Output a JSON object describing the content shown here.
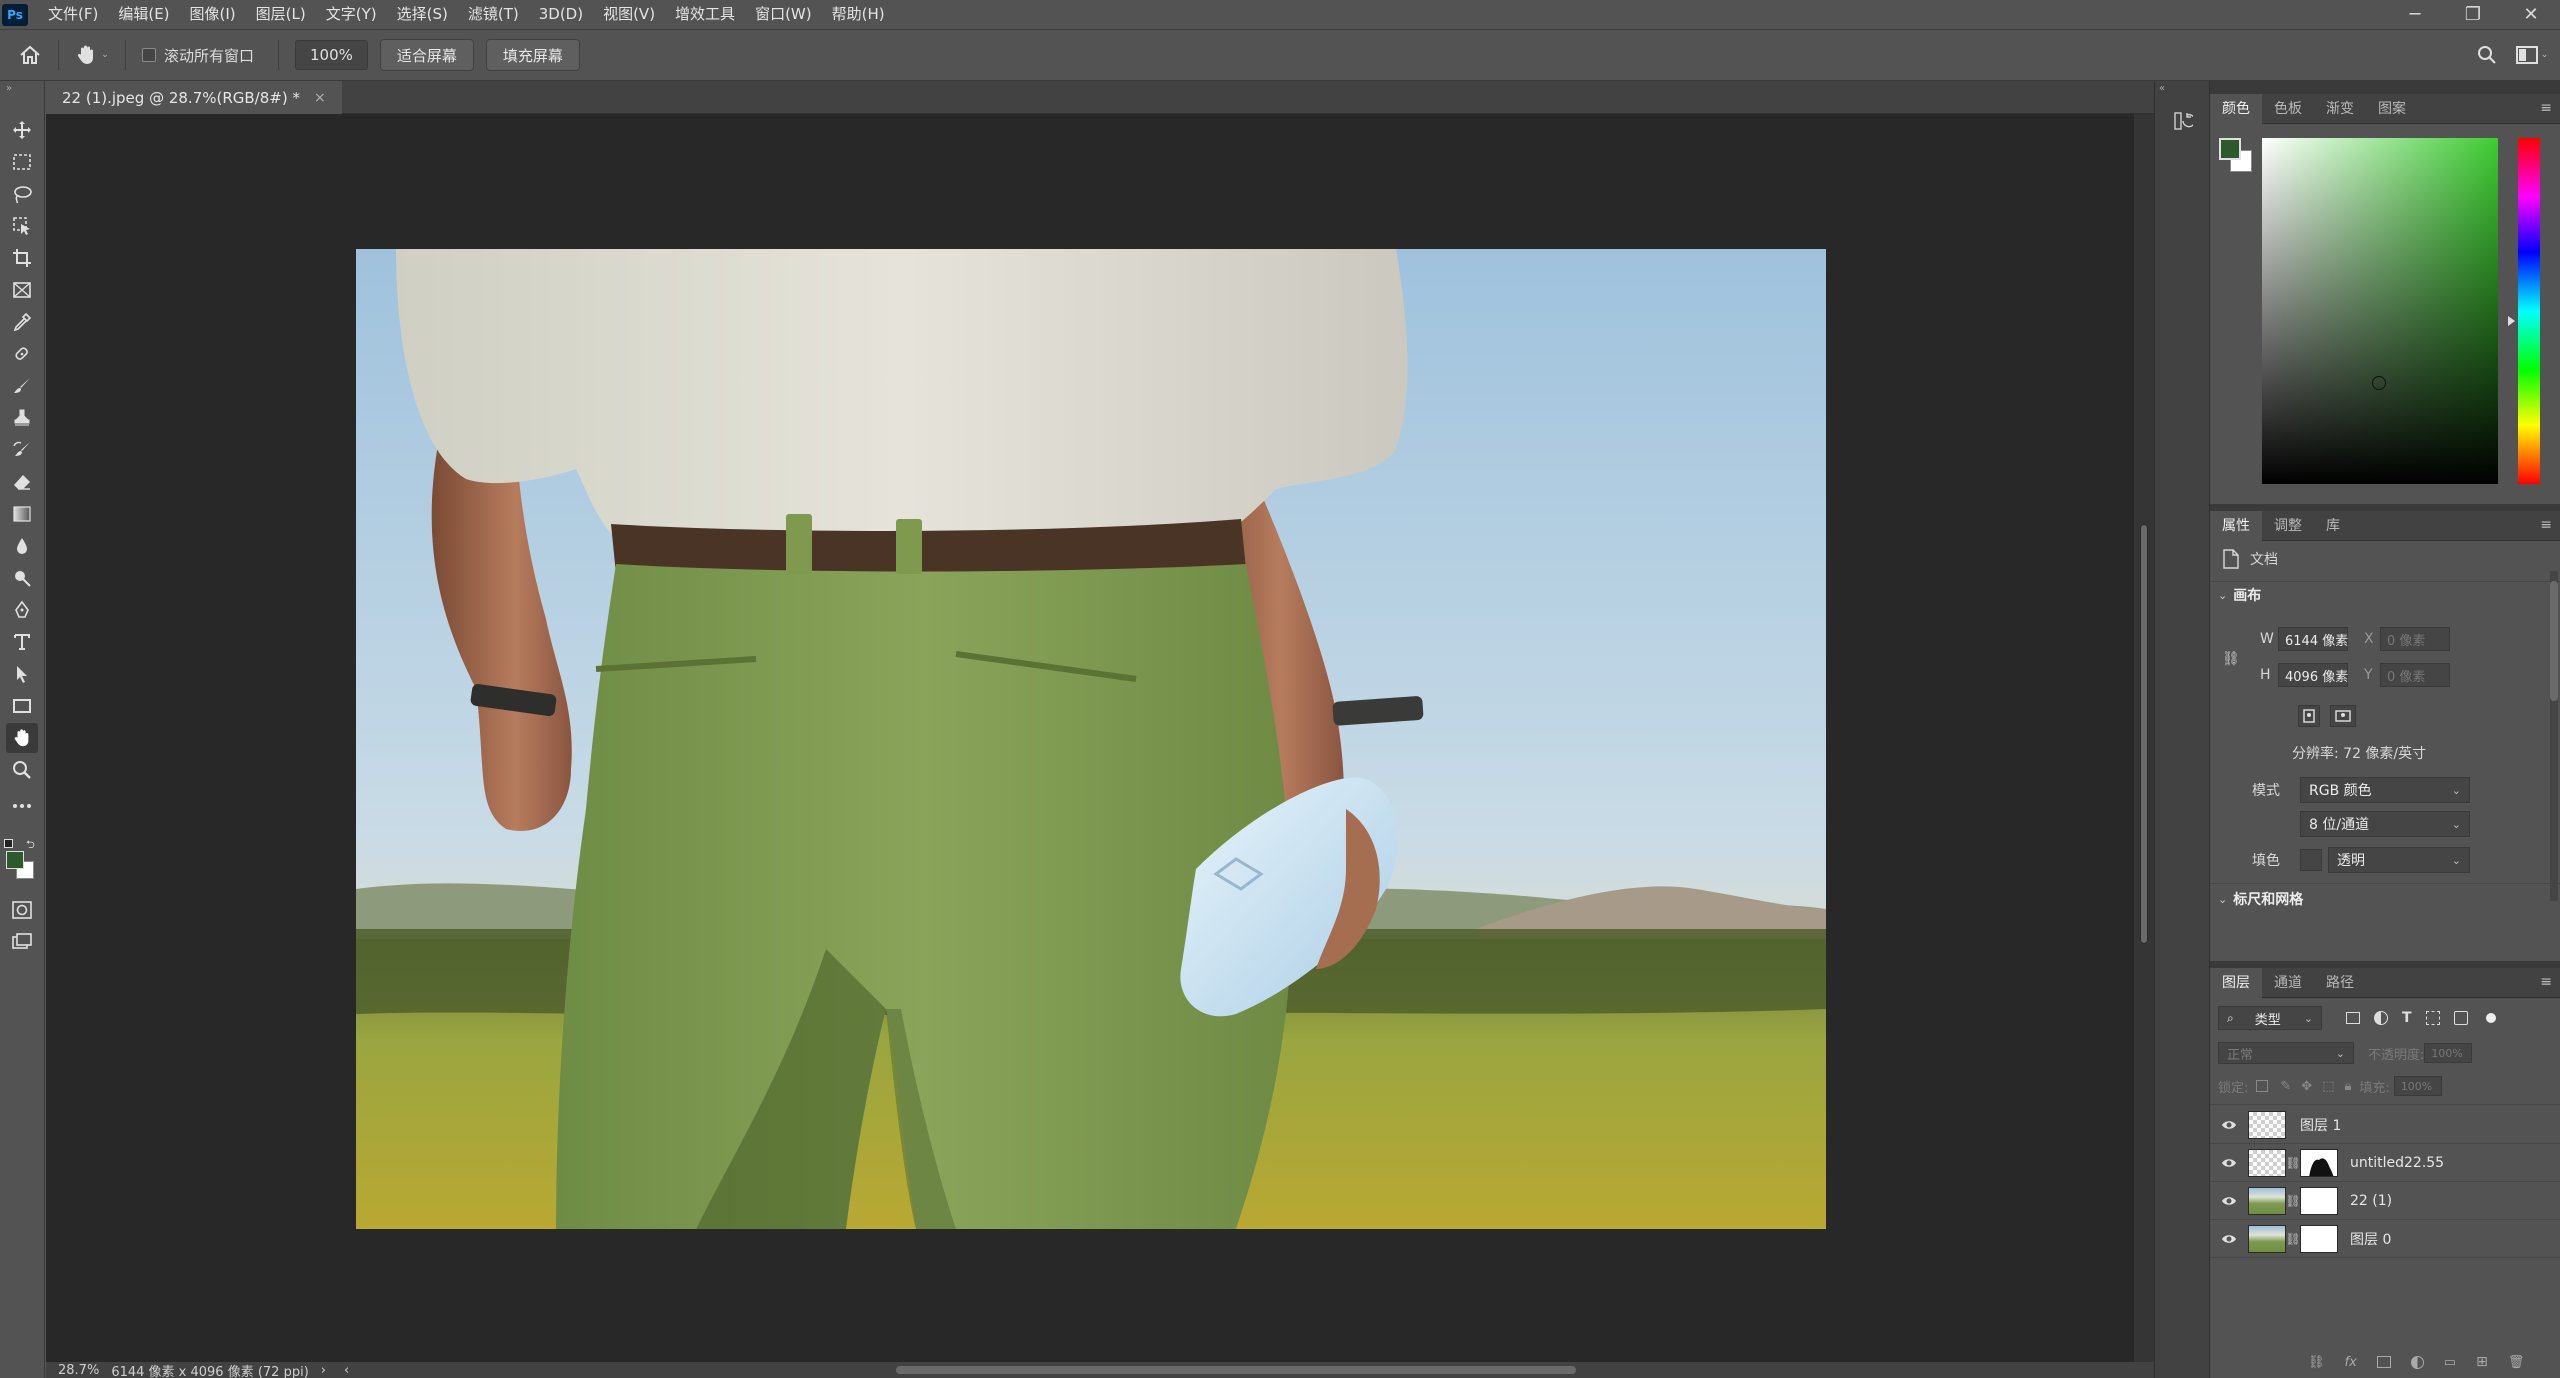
{
  "app": {
    "logo": "Ps"
  },
  "menubar": {
    "items": [
      "文件(F)",
      "编辑(E)",
      "图像(I)",
      "图层(L)",
      "文字(Y)",
      "选择(S)",
      "滤镜(T)",
      "3D(D)",
      "视图(V)",
      "增效工具",
      "窗口(W)",
      "帮助(H)"
    ],
    "window_controls": {
      "minimize": "─",
      "restore": "❐",
      "close": "✕"
    }
  },
  "options": {
    "scroll_all_label": "滚动所有窗口",
    "zoom_value": "100%",
    "fit_screen": "适合屏幕",
    "fill_screen": "填充屏幕"
  },
  "document": {
    "tab_title": "22 (1).jpeg @ 28.7%(RGB/8#) *",
    "tab_close": "×"
  },
  "status": {
    "zoom": "28.7%",
    "size_info": "6144 像素 x 4096 像素 (72 ppi)",
    "arrow": "›",
    "left_arrow": "‹"
  },
  "color_panel": {
    "tabs": [
      "颜色",
      "色板",
      "渐变",
      "图案"
    ],
    "foreground": "#2d5a2d",
    "background": "#ffffff",
    "hue_color": "#3ecc32"
  },
  "properties_panel": {
    "tabs": [
      "属性",
      "调整",
      "库"
    ],
    "doc_label": "文档",
    "canvas_header": "画布",
    "w_label": "W",
    "w_value": "6144 像素",
    "h_label": "H",
    "h_value": "4096 像素",
    "x_label": "X",
    "x_value": "0 像素",
    "y_label": "Y",
    "y_value": "0 像素",
    "resolution": "分辨率: 72 像素/英寸",
    "mode_label": "模式",
    "mode_value": "RGB 颜色",
    "depth_value": "8 位/通道",
    "fill_label": "填色",
    "fill_value": "透明",
    "rulers_header": "标尺和网格"
  },
  "layers_panel": {
    "tabs": [
      "图层",
      "通道",
      "路径"
    ],
    "filter_kind": "类型",
    "blend_mode": "正常",
    "opacity_label": "不透明度:",
    "opacity_value": "100%",
    "lock_label": "锁定:",
    "fill_label": "填充:",
    "fill_value": "100%",
    "layers": [
      {
        "name": "图层 1"
      },
      {
        "name": "untitled22.55"
      },
      {
        "name": "22 (1)"
      },
      {
        "name": "图层 0"
      }
    ]
  }
}
